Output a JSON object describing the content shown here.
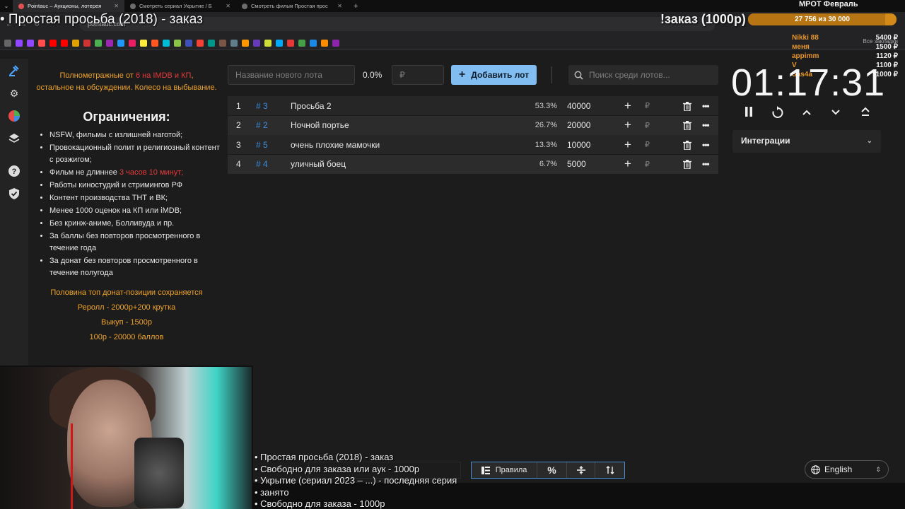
{
  "browser": {
    "tabs": [
      {
        "title": "Pointauc – Аукционы, лотерея"
      },
      {
        "title": "Смотреть сериал Укрытие / Б"
      },
      {
        "title": "Смотреть фильм Простая прос"
      }
    ],
    "url": "pointauc.com",
    "all_bookmarks": "Все закладки"
  },
  "overlay": {
    "title": "• Простая просьба (2018) - заказ",
    "order": "!заказ (1000р)",
    "mrot_title": "МРОТ Февраль",
    "mrot_progress": "27 756  из 30 000",
    "mrot_fraction": 0.9252,
    "donors": [
      {
        "name": "Nikki 88",
        "amount": "5400 ₽"
      },
      {
        "name": "меня",
        "amount": "1500 ₽"
      },
      {
        "name": "appimm",
        "amount": "1120 ₽"
      },
      {
        "name": "V",
        "amount": "1100 ₽"
      },
      {
        "name": "Sas4a",
        "amount": "1000 ₽"
      }
    ]
  },
  "rules": {
    "intro_a": "Полнометражные от ",
    "intro_b": "6 на IMDB и КП",
    "intro_c": ",",
    "intro_d": "остальное на обсуждении. Колесо на выбывание.",
    "heading": "Ограничения:",
    "items": [
      "NSFW, фильмы с излишней наготой;",
      "Провокационный полит и религиозный контент с розжигом;",
      "Фильм не длиннее ",
      "Работы киностудий и стримингов РФ",
      "Контент производства ТНТ и ВК;",
      "Менее 1000 оценок на КП или iMDB;",
      "Без кринж-аниме, Болливуда и пр.",
      "За баллы без повторов просмотренного в течение года",
      "За донат без повторов просмотренного в течение полугода"
    ],
    "duration_limit": "3 часов 10 минут;",
    "footer": [
      "Половина топ донат-позиции сохраняется",
      "Реролл - 2000р+200 крутка",
      "Выкуп - 1500р",
      "100р - 20000 баллов"
    ]
  },
  "controls": {
    "lot_name_placeholder": "Название нового лота",
    "percent": "0.0%",
    "price_placeholder": "₽",
    "add_label": "Добавить лот",
    "search_placeholder": "Поиск среди лотов..."
  },
  "lots": [
    {
      "index": "1",
      "id": "# 3",
      "name": "Просьба 2",
      "percent": "53.3%",
      "amount": "40000"
    },
    {
      "index": "2",
      "id": "# 2",
      "name": "Ночной портье",
      "percent": "26.7%",
      "amount": "20000"
    },
    {
      "index": "3",
      "id": "# 5",
      "name": "очень плохие мамочки",
      "percent": "13.3%",
      "amount": "10000"
    },
    {
      "index": "4",
      "id": "# 4",
      "name": "уличный  боец",
      "percent": "6.7%",
      "amount": "5000"
    }
  ],
  "currency": "₽",
  "timer": "01:17:31",
  "integrations_label": "Интеграции",
  "bottom": {
    "rules_label": "Правила",
    "percent_label": "%",
    "language": "English"
  },
  "queue": [
    "• Простая просьба (2018) - заказ",
    "• Свободно для заказа или аук - 1000р",
    "• Укрытие (сериал 2023 – ...) - последняя серия",
    "• занято",
    "• Свободно для заказа - 1000р"
  ],
  "accent_color": "#82bdf2",
  "id_color": "#3d8ee0"
}
